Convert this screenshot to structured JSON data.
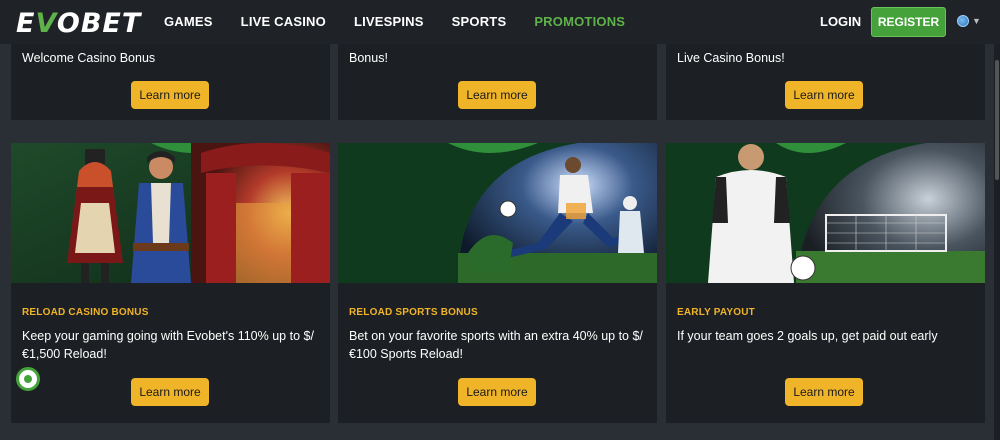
{
  "header": {
    "logo_prefix": "E",
    "logo_v": "V",
    "logo_rest": "OBET",
    "nav": [
      {
        "label": "GAMES"
      },
      {
        "label": "LIVE CASINO"
      },
      {
        "label": "LIVESPINS"
      },
      {
        "label": "SPORTS"
      },
      {
        "label": "PROMOTIONS"
      }
    ],
    "login_label": "LOGIN",
    "register_label": "REGISTER",
    "language_icon": "globe-icon"
  },
  "top_cards": [
    {
      "text": "Welcome Casino Bonus",
      "button": "Learn more"
    },
    {
      "text": "Bonus!",
      "button": "Learn more"
    },
    {
      "text": "Live Casino Bonus!",
      "button": "Learn more"
    }
  ],
  "promo_cards": [
    {
      "title": "RELOAD CASINO BONUS",
      "text": "Keep your gaming going with Evobet's 110% up to $/€1,500 Reload!",
      "button": "Learn more"
    },
    {
      "title": "RELOAD SPORTS BONUS",
      "text": "Bet on your favorite sports with an extra 40% up to $/€100 Sports Reload!",
      "button": "Learn more"
    },
    {
      "title": "EARLY PAYOUT",
      "text": "If your team goes 2 goals up, get paid out early",
      "button": "Learn more"
    }
  ],
  "colors": {
    "accent_green": "#5fb24a",
    "button_yellow": "#f0b429",
    "card_bg": "#1c1f23",
    "page_bg": "#2a2f35"
  }
}
